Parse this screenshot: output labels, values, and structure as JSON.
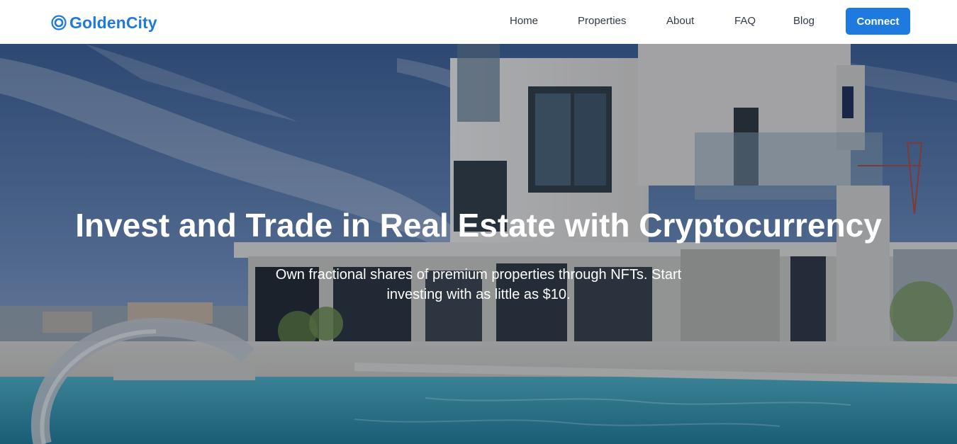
{
  "brand": {
    "name": "GoldenCity",
    "color": "#1f7ae0",
    "icon": "ring-logo-icon"
  },
  "nav": {
    "items": [
      {
        "label": "Home"
      },
      {
        "label": "Properties"
      },
      {
        "label": "About"
      },
      {
        "label": "FAQ"
      },
      {
        "label": "Blog"
      }
    ],
    "connect_label": "Connect"
  },
  "hero": {
    "title": "Invest and Trade in Real Estate with Cryptocurrency",
    "subtitle": "Own fractional shares of premium properties through NFTs. Start investing with as little as $10.",
    "background": "modern-villa-with-pool-image"
  }
}
